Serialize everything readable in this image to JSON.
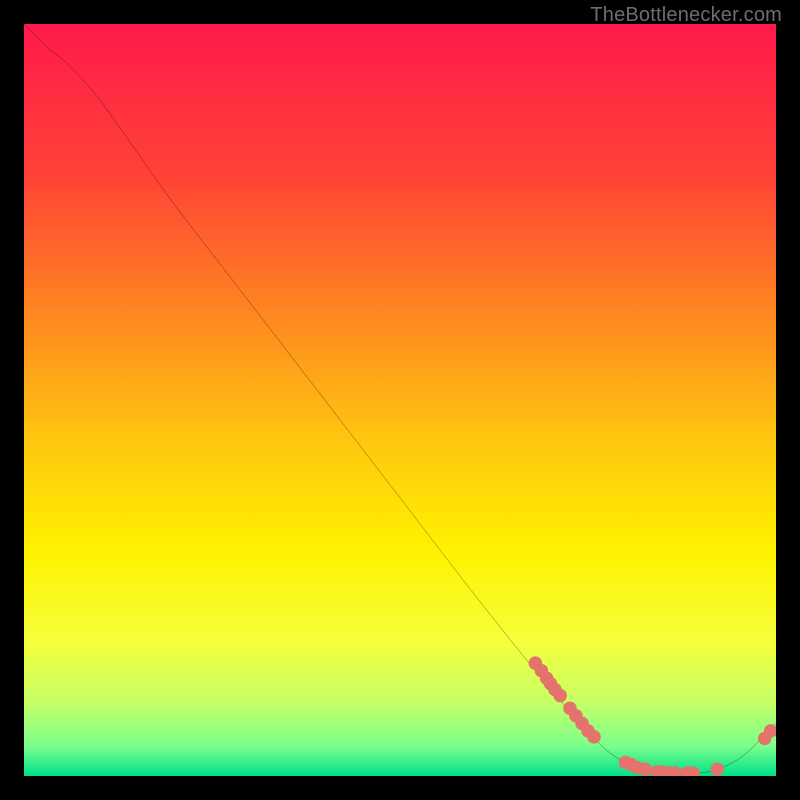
{
  "watermark": "TheBottlenecker.com",
  "chart_data": {
    "type": "line",
    "title": "",
    "xlabel": "",
    "ylabel": "",
    "xlim": [
      0,
      100
    ],
    "ylim": [
      0,
      100
    ],
    "background_gradient": {
      "stops": [
        {
          "offset": 0.0,
          "color": "#ff1a4b"
        },
        {
          "offset": 0.2,
          "color": "#ff4236"
        },
        {
          "offset": 0.4,
          "color": "#ff8c1f"
        },
        {
          "offset": 0.55,
          "color": "#ffc50f"
        },
        {
          "offset": 0.7,
          "color": "#fff200"
        },
        {
          "offset": 0.82,
          "color": "#f5ff3a"
        },
        {
          "offset": 0.9,
          "color": "#c8ff66"
        },
        {
          "offset": 0.96,
          "color": "#7bff8a"
        },
        {
          "offset": 1.0,
          "color": "#00e08a"
        }
      ]
    },
    "series": [
      {
        "name": "curve",
        "type": "line",
        "points": [
          {
            "x": 0,
            "y": 100
          },
          {
            "x": 3,
            "y": 97
          },
          {
            "x": 6,
            "y": 94.5
          },
          {
            "x": 10,
            "y": 90
          },
          {
            "x": 15,
            "y": 83
          },
          {
            "x": 20,
            "y": 76
          },
          {
            "x": 30,
            "y": 63
          },
          {
            "x": 40,
            "y": 50
          },
          {
            "x": 50,
            "y": 37
          },
          {
            "x": 60,
            "y": 24
          },
          {
            "x": 68,
            "y": 14
          },
          {
            "x": 74,
            "y": 7
          },
          {
            "x": 78,
            "y": 3
          },
          {
            "x": 82,
            "y": 1
          },
          {
            "x": 86,
            "y": 0.4
          },
          {
            "x": 90,
            "y": 0.4
          },
          {
            "x": 93,
            "y": 1.2
          },
          {
            "x": 96,
            "y": 3
          },
          {
            "x": 100,
            "y": 7
          }
        ]
      },
      {
        "name": "markers",
        "type": "scatter",
        "points": [
          {
            "x": 68,
            "y": 15
          },
          {
            "x": 68.8,
            "y": 14
          },
          {
            "x": 69.5,
            "y": 13
          },
          {
            "x": 70,
            "y": 12.3
          },
          {
            "x": 70.6,
            "y": 11.5
          },
          {
            "x": 71.3,
            "y": 10.7
          },
          {
            "x": 72.6,
            "y": 9
          },
          {
            "x": 73.4,
            "y": 8
          },
          {
            "x": 74.2,
            "y": 7
          },
          {
            "x": 75,
            "y": 6
          },
          {
            "x": 75.8,
            "y": 5.2
          },
          {
            "x": 80,
            "y": 1.8
          },
          {
            "x": 80.8,
            "y": 1.5
          },
          {
            "x": 81.6,
            "y": 1.1
          },
          {
            "x": 82.6,
            "y": 0.9
          },
          {
            "x": 84.2,
            "y": 0.55
          },
          {
            "x": 85,
            "y": 0.5
          },
          {
            "x": 85.8,
            "y": 0.4
          },
          {
            "x": 86.6,
            "y": 0.4
          },
          {
            "x": 88.2,
            "y": 0.4
          },
          {
            "x": 89,
            "y": 0.4
          },
          {
            "x": 92.2,
            "y": 0.9
          },
          {
            "x": 98.5,
            "y": 5
          },
          {
            "x": 99.3,
            "y": 6
          }
        ]
      }
    ]
  }
}
